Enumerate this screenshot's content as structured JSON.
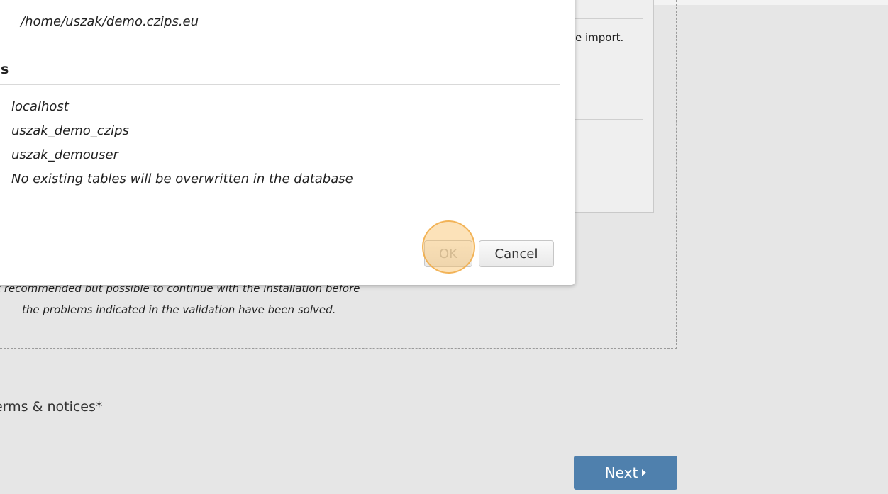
{
  "background_panel": {
    "import_text_fragment": "e import.",
    "warning_line1": "ot recommended but possible to continue with the installation before",
    "warning_line2": "the problems indicated in the validation have been solved.",
    "terms_link": "erms & notices",
    "terms_required_marker": "*",
    "next_label": "Next"
  },
  "modal": {
    "path": "/home/uszak/demo.czips.eu",
    "section_heading": "s",
    "values": [
      "localhost",
      "uszak_demo_czips",
      "uszak_demouser",
      "No existing tables will be overwritten in the database"
    ],
    "ok_label": "OK",
    "cancel_label": "Cancel"
  },
  "colors": {
    "next_button": "#4f80ad",
    "click_highlight": "#f9be64",
    "page_background": "#e6e6e6"
  },
  "icons": {
    "next_arrow": "caret-right-icon"
  }
}
